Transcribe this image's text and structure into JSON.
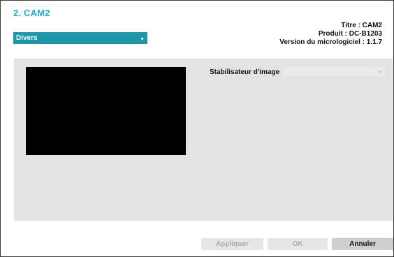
{
  "window": {
    "title": "2. CAM2"
  },
  "info": {
    "titre": "Titre : CAM2",
    "produit": "Produit : DC-B1203",
    "version": "Version du micrologiciel : 1.1.7"
  },
  "category_select": {
    "value": "Divers",
    "icon": "chevron-down-icon"
  },
  "settings": {
    "stabilizer_label": "Stabilisateur d'image",
    "stabilizer_value": ""
  },
  "buttons": {
    "apply": "Appliquer",
    "ok": "OK",
    "cancel": "Annuler"
  },
  "colors": {
    "accent_title": "#2aa7c9",
    "dropdown_bg": "#1f95a8",
    "panel_bg": "#e3e3e3",
    "disabled_text": "#a9a9a9"
  }
}
